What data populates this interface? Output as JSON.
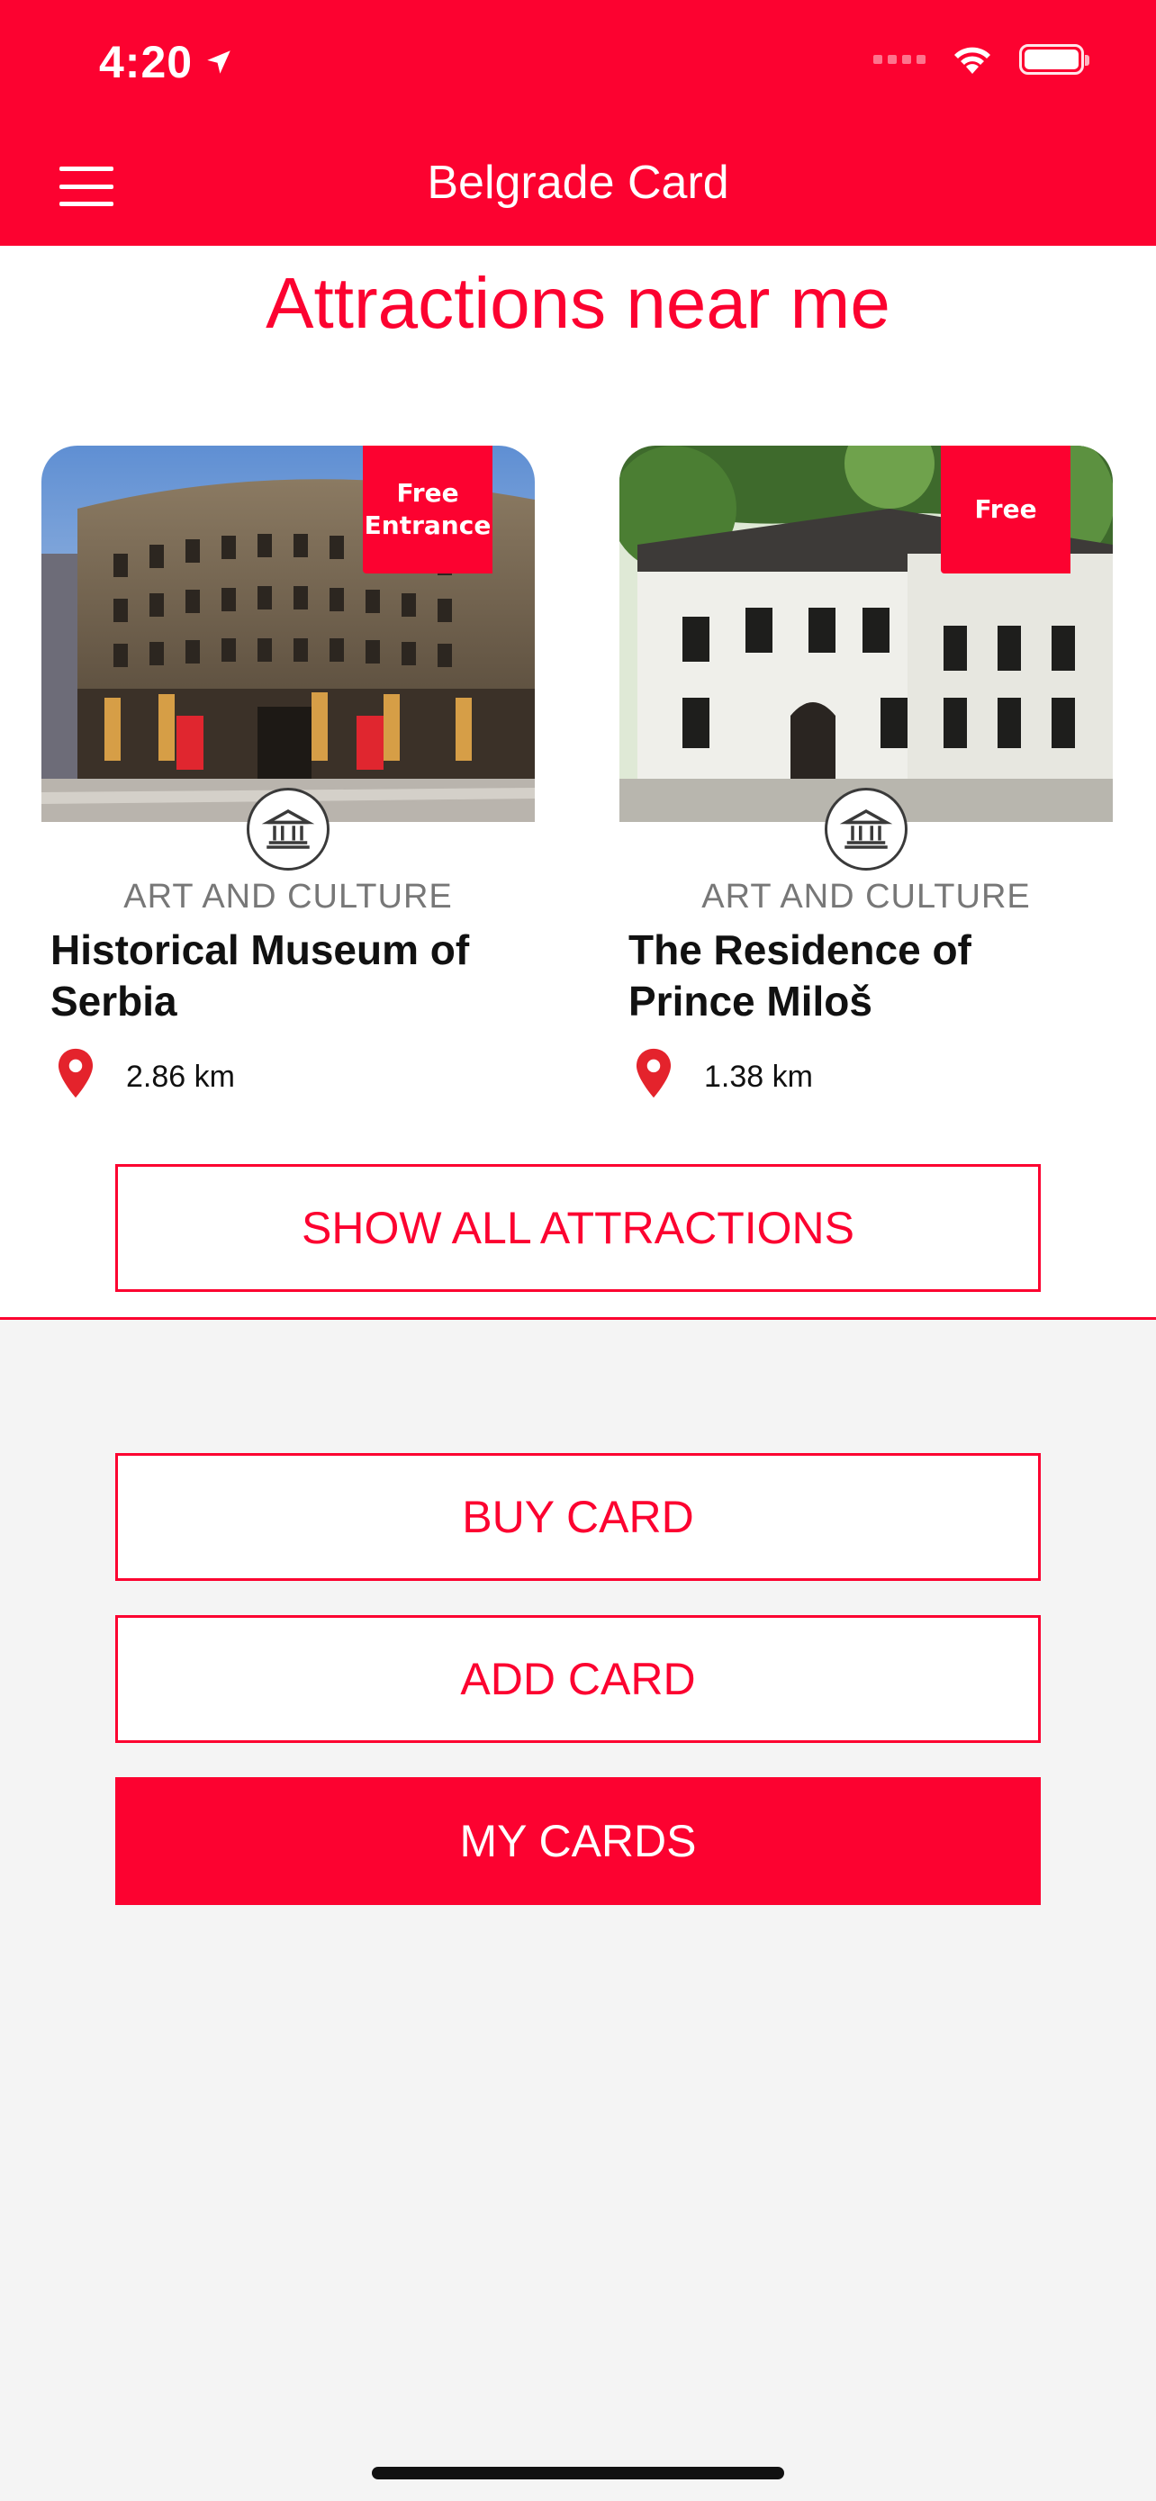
{
  "status_bar": {
    "time": "4:20"
  },
  "header": {
    "title": "Belgrade Card"
  },
  "section": {
    "title": "Attractions near me"
  },
  "attractions": [
    {
      "badge": "Free Entrance",
      "category": "ART AND CULTURE",
      "name": "Historical Museum of Serbia",
      "distance": "2.86 km"
    },
    {
      "badge": "Free",
      "category": "ART AND CULTURE",
      "name": "The Residence of Prince Miloš",
      "distance": "1.38 km"
    }
  ],
  "buttons": {
    "show_all": "SHOW ALL ATTRACTIONS",
    "buy_card": "BUY CARD",
    "add_card": "ADD CARD",
    "my_cards": "MY CARDS"
  },
  "colors": {
    "brand": "#fc0230",
    "background": "#f4f4f4"
  },
  "icons": {
    "menu": "hamburger-menu-icon",
    "location_arrow": "location-arrow-icon",
    "wifi": "wifi-icon",
    "battery": "battery-icon",
    "category": "museum-icon",
    "distance": "map-pin-icon"
  }
}
